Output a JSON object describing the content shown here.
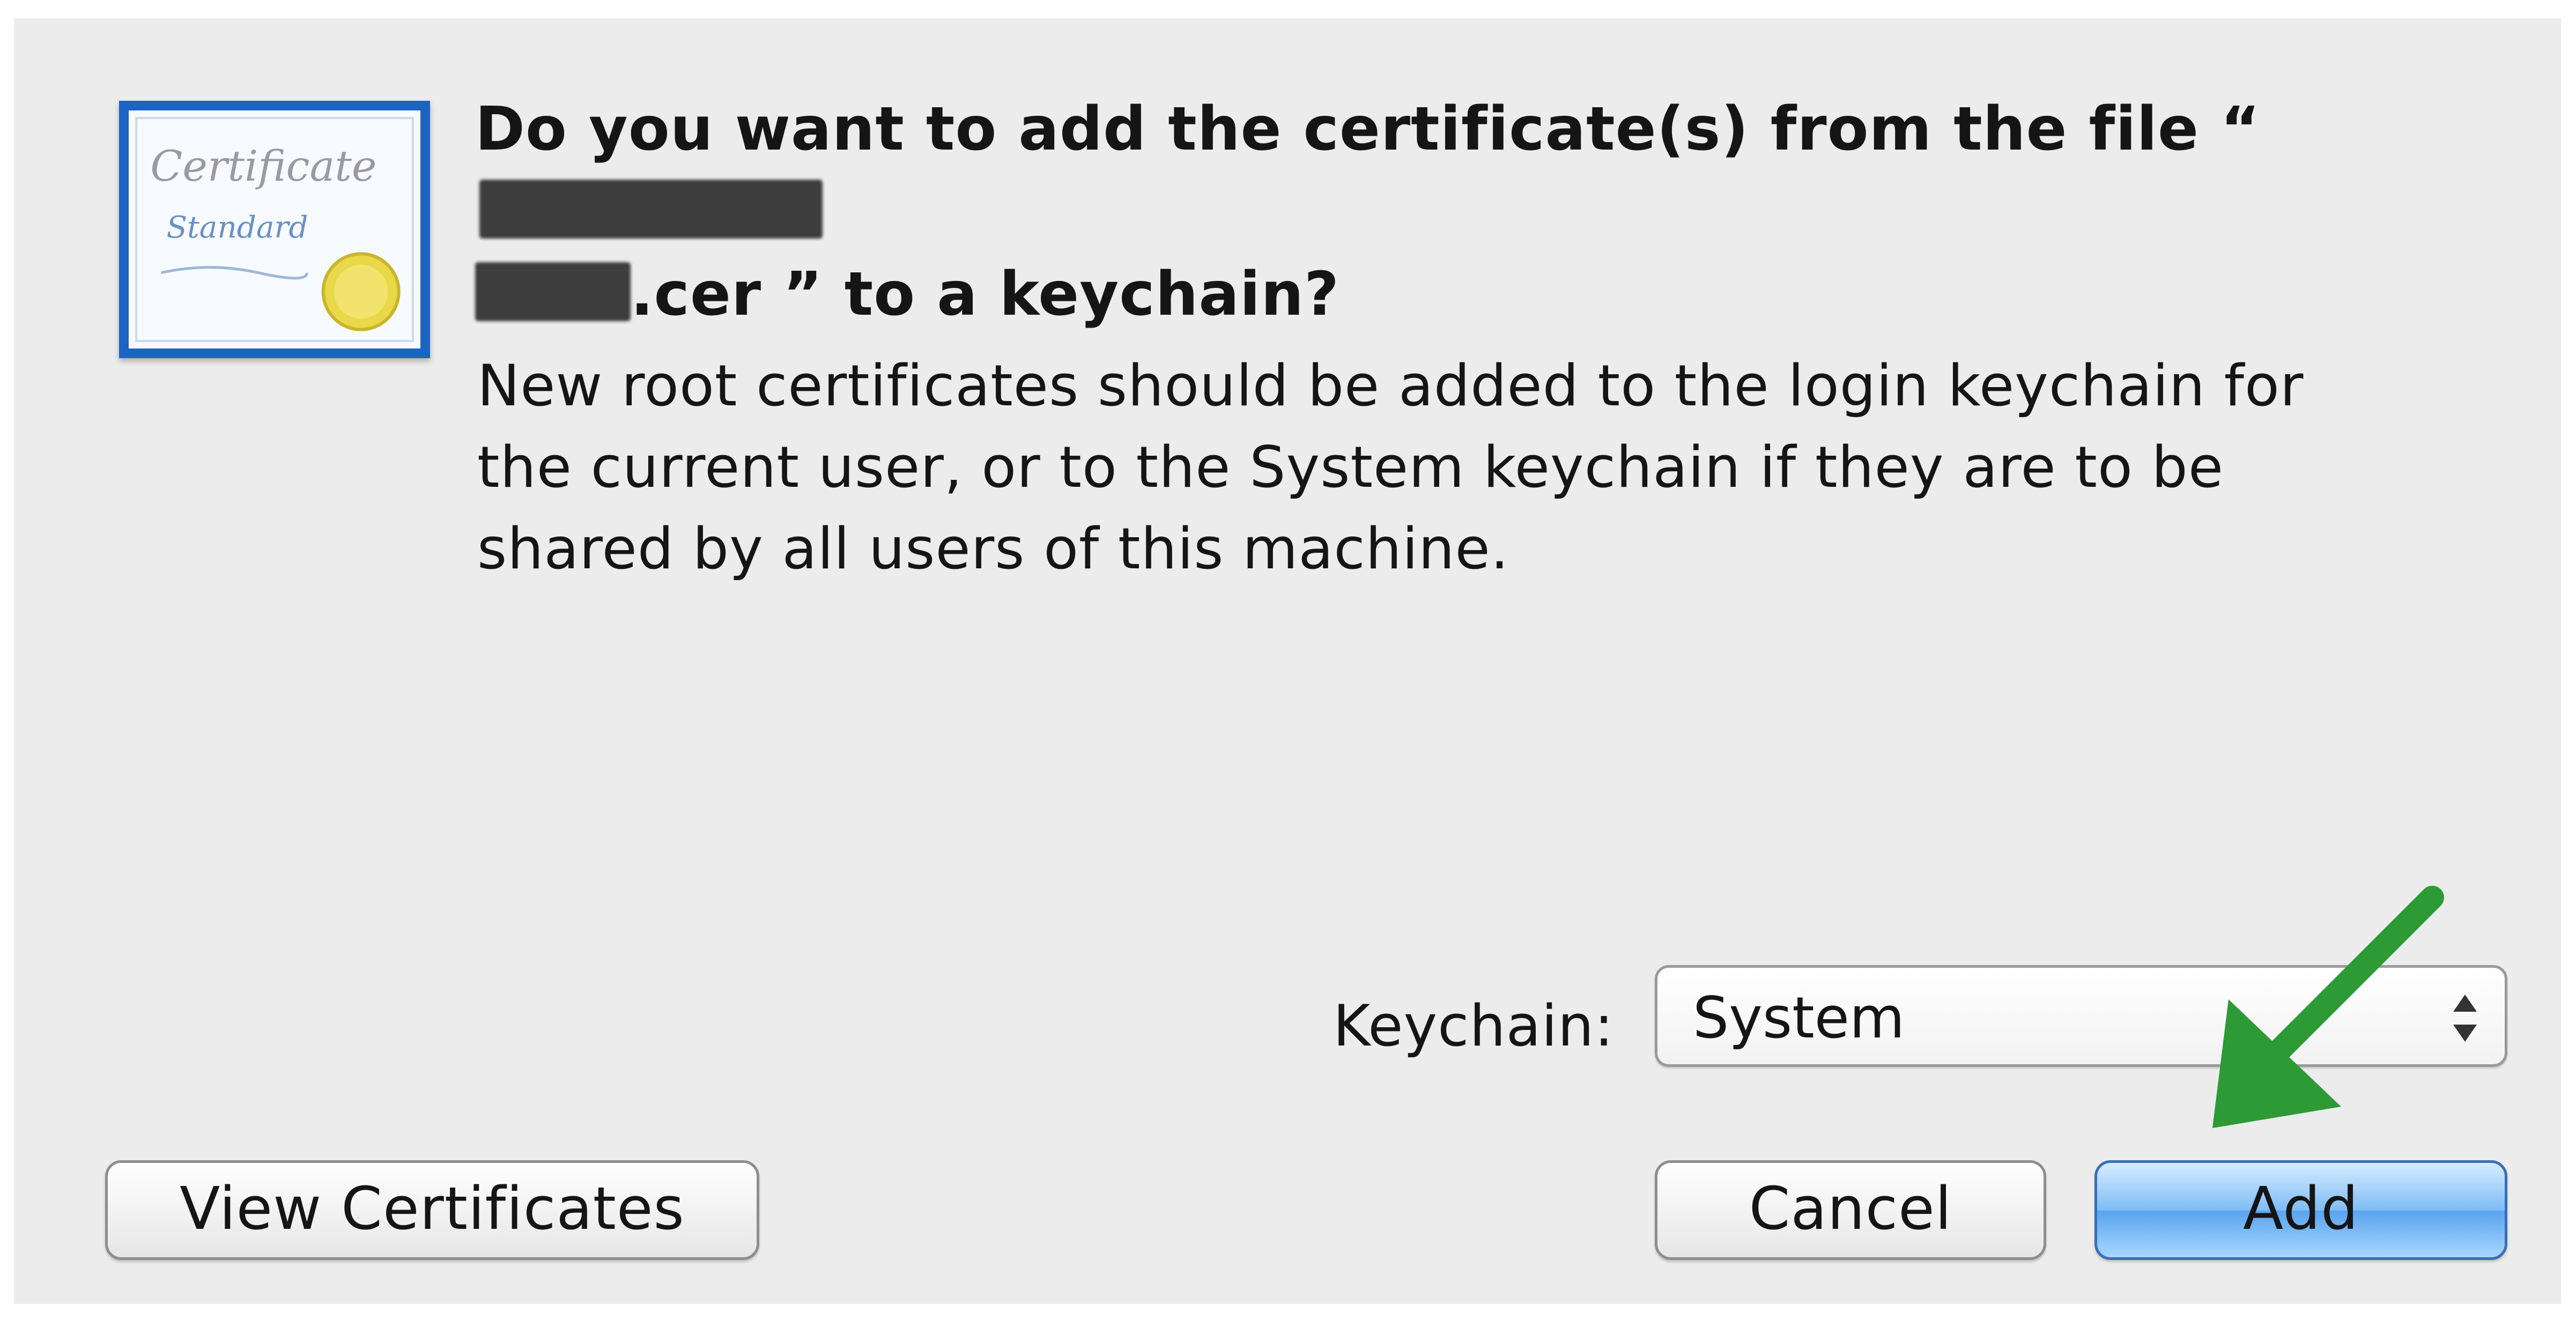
{
  "dialog": {
    "title_part1": "Do you want to add the certificate(s) from the file “",
    "title_part2": ".cer ” to a keychain?",
    "message": "New root certificates should be added to the login keychain for\nthe current user, or to the System keychain if they are to be\nshared by all users of this machine.",
    "icon_text_top": "Certificate",
    "icon_text_mid": "Standard"
  },
  "keychain": {
    "label": "Keychain:",
    "selected": "System"
  },
  "buttons": {
    "view_certificates": "View Certificates",
    "cancel": "Cancel",
    "add": "Add"
  },
  "colors": {
    "dialog_bg": "#ececec",
    "default_button": "#7fbdf7",
    "annotation_arrow": "#2c9a35"
  }
}
